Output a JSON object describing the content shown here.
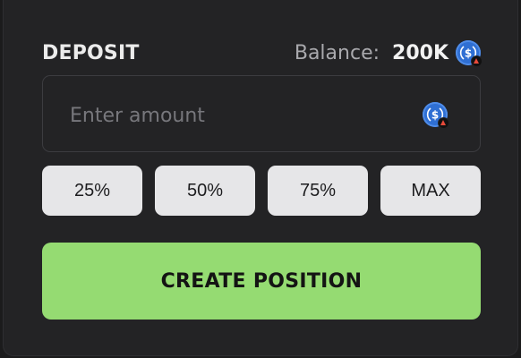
{
  "deposit": {
    "title": "DEPOSIT",
    "balance_label": "Balance:",
    "balance_value": "200K",
    "token_icon": "usdc-coin-icon",
    "network_badge_icon": "network-badge-icon"
  },
  "amount_input": {
    "placeholder": "Enter amount",
    "value": ""
  },
  "percent_buttons": [
    {
      "label": "25%"
    },
    {
      "label": "50%"
    },
    {
      "label": "75%"
    },
    {
      "label": "MAX"
    }
  ],
  "cta": {
    "label": "CREATE POSITION"
  },
  "colors": {
    "background": "#1b1b1c",
    "panel": "#232325",
    "accent_green": "#95db72",
    "button_light": "#e6e6e8",
    "coin_blue": "#2f6fd3"
  }
}
